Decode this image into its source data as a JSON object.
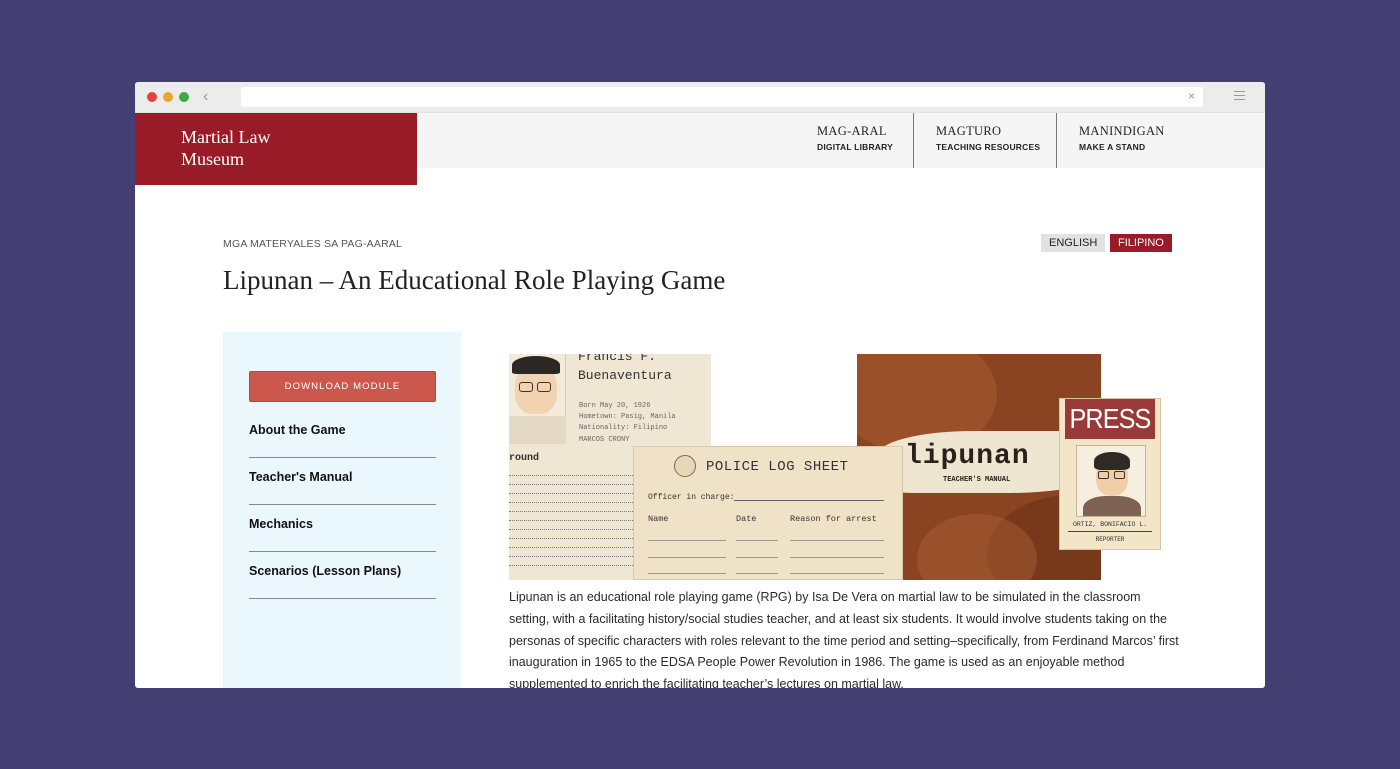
{
  "browser": {
    "back_glyph": "‹",
    "clear_glyph": "×",
    "menu_icon": "hamburger-icon"
  },
  "site": {
    "brand_line1": "Martial Law",
    "brand_line2": "Museum",
    "brand_color": "#9a1b28"
  },
  "nav": [
    {
      "main": "MAG-ARAL",
      "sub": "DIGITAL LIBRARY"
    },
    {
      "main": "MAGTURO",
      "sub": "TEACHING RESOURCES"
    },
    {
      "main": "MANINDIGAN",
      "sub": "MAKE A STAND"
    }
  ],
  "page": {
    "breadcrumb": "MGA MATERYALES SA PAG-AARAL",
    "title": "Lipunan – An Educational Role Playing Game",
    "lang_en": "ENGLISH",
    "lang_fil": "FILIPINO"
  },
  "sidebar": {
    "download_label": "DOWNLOAD MODULE",
    "download_color": "#cc574d",
    "links": [
      "About the Game",
      "Teacher's Manual",
      "Mechanics",
      "Scenarios (Lesson Plans)"
    ]
  },
  "hero": {
    "char_name_line1": "Francis F.",
    "char_name_line2": "Buenaventura",
    "char_info": [
      "Born May 20, 1926",
      "Hometown: Pasig, Manila",
      "Nationality: Filipino",
      "MARCOS CRONY"
    ],
    "char_background_label": "round",
    "police_title": "POLICE LOG SHEET",
    "police_officer": "Officer in charge:",
    "police_cols": [
      "Name",
      "Date",
      "Reason for arrest"
    ],
    "manual_title": "lipunan",
    "manual_sub": "TEACHER'S MANUAL",
    "press_label": "PRESS",
    "press_name": "ORTIZ, BONIFACIO L.",
    "press_role": "REPORTER"
  },
  "description": "Lipunan is an educational role playing game (RPG) by Isa De Vera on martial law to be simulated in the classroom setting, with a facilitating history/social studies teacher, and at least six students. It would involve students taking on the personas of specific characters with roles relevant to the time period and setting–specifically, from Ferdinand Marcos’ first inauguration in 1965 to the EDSA People Power Revolution in 1986. The game is used as an enjoyable method supplemented to enrich the facilitating teacher’s lectures on martial law."
}
